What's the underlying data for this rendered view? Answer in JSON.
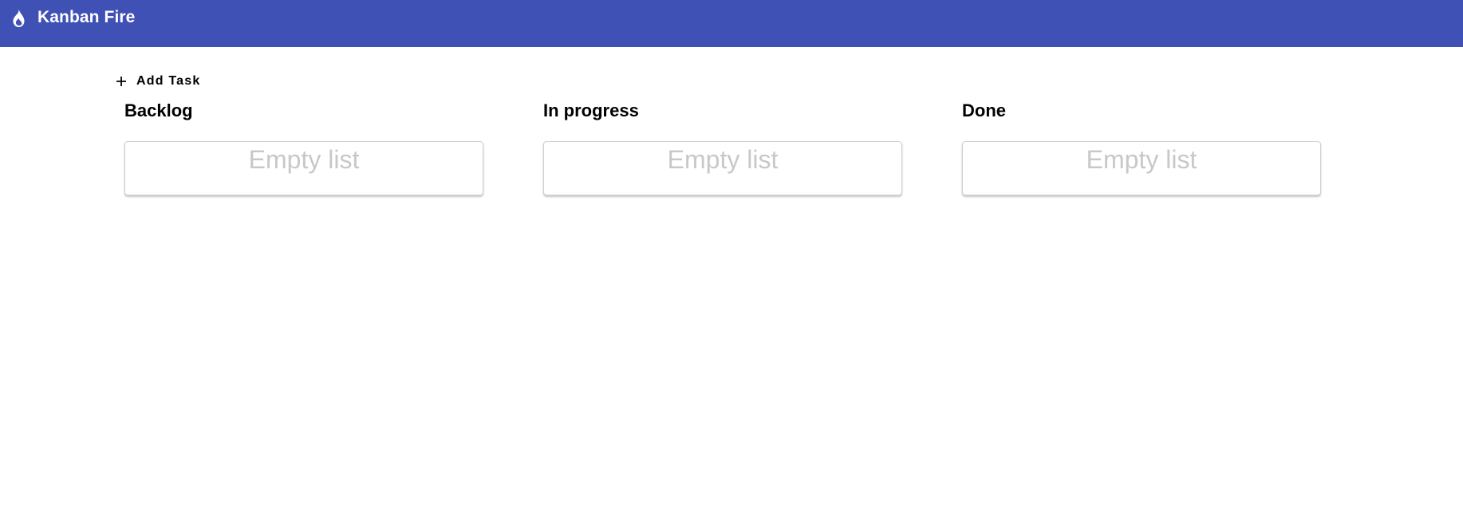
{
  "theme": {
    "primary": "#3f51b5",
    "on_primary": "#ffffff",
    "empty_text_color": "#c8c8c8"
  },
  "toolbar": {
    "icon": "fire-icon",
    "title": "Kanban Fire"
  },
  "actions": {
    "add_task_icon": "plus-icon",
    "add_task_label": "Add Task"
  },
  "board": {
    "columns": [
      {
        "title": "Backlog",
        "empty_label": "Empty list"
      },
      {
        "title": "In progress",
        "empty_label": "Empty list"
      },
      {
        "title": "Done",
        "empty_label": "Empty list"
      }
    ]
  }
}
